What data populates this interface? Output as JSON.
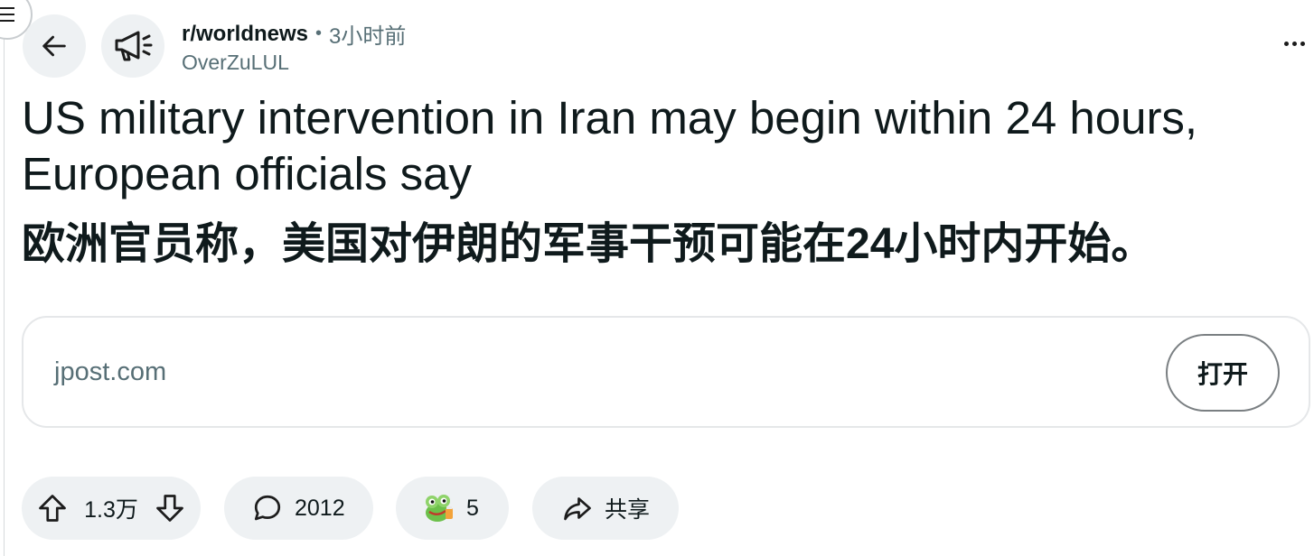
{
  "post": {
    "subreddit": "r/worldnews",
    "separator": "•",
    "time": "3小时前",
    "author": "OverZuLUL",
    "title_en": "US military intervention in Iran may begin within 24 hours, European officials say",
    "title_zh": "欧洲官员称，美国对伊朗的军事干预可能在24小时内开始。"
  },
  "link": {
    "domain": "jpost.com",
    "open_label": "打开"
  },
  "actions": {
    "votes": "1.3万",
    "comments": "2012",
    "awards": "5",
    "share_label": "共享"
  },
  "icons": {
    "menu": "menu-icon",
    "back": "back-arrow-icon",
    "subreddit": "megaphone-icon",
    "more": "more-options-icon",
    "upvote": "upvote-icon",
    "downvote": "downvote-icon",
    "comment": "comment-icon",
    "award": "award-icon",
    "share": "share-icon"
  },
  "colors": {
    "text": "#0f1a1c",
    "muted": "#576f76",
    "pill_bg": "#eef1f3"
  }
}
